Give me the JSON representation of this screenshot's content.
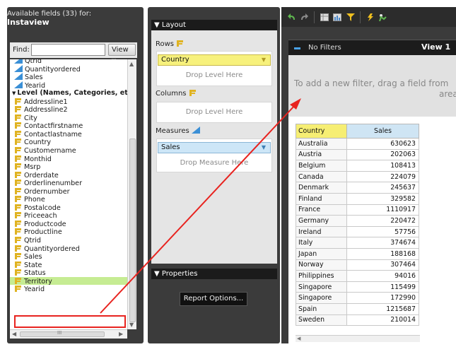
{
  "left": {
    "header_line1": "Available fields (33) for:",
    "header_line2": "Instaview",
    "find_label": "Find:",
    "find_value": "",
    "view_label": "View",
    "view_arrow": "▽",
    "fields": [
      {
        "label": "Qtrid",
        "kind": "measure",
        "partial": true
      },
      {
        "label": "Quantityordered",
        "kind": "measure"
      },
      {
        "label": "Sales",
        "kind": "measure"
      },
      {
        "label": "Yearid",
        "kind": "measure"
      },
      {
        "label": "Level (Names, Categories, etc",
        "kind": "group"
      },
      {
        "label": "Addressline1",
        "kind": "level"
      },
      {
        "label": "Addressline2",
        "kind": "level"
      },
      {
        "label": "City",
        "kind": "level"
      },
      {
        "label": "Contactfirstname",
        "kind": "level"
      },
      {
        "label": "Contactlastname",
        "kind": "level"
      },
      {
        "label": "Country",
        "kind": "level"
      },
      {
        "label": "Customername",
        "kind": "level"
      },
      {
        "label": "Monthid",
        "kind": "level"
      },
      {
        "label": "Msrp",
        "kind": "level"
      },
      {
        "label": "Orderdate",
        "kind": "level"
      },
      {
        "label": "Orderlinenumber",
        "kind": "level"
      },
      {
        "label": "Ordernumber",
        "kind": "level"
      },
      {
        "label": "Phone",
        "kind": "level"
      },
      {
        "label": "Postalcode",
        "kind": "level"
      },
      {
        "label": "Priceeach",
        "kind": "level"
      },
      {
        "label": "Productcode",
        "kind": "level"
      },
      {
        "label": "Productline",
        "kind": "level"
      },
      {
        "label": "Qtrid",
        "kind": "level"
      },
      {
        "label": "Quantityordered",
        "kind": "level"
      },
      {
        "label": "Sales",
        "kind": "level"
      },
      {
        "label": "State",
        "kind": "level"
      },
      {
        "label": "Status",
        "kind": "level"
      },
      {
        "label": "Territory",
        "kind": "level",
        "highlight": true
      },
      {
        "label": "Yearid",
        "kind": "level"
      }
    ],
    "hscroll_grip": "III"
  },
  "layout": {
    "title": "▼ Layout",
    "rows_label": "Rows",
    "rows_chip": "Country",
    "rows_drop": "Drop Level Here",
    "columns_label": "Columns",
    "columns_drop": "Drop Level Here",
    "measures_label": "Measures",
    "measures_chip": "Sales",
    "measures_drop": "Drop Measure Here",
    "properties_title": "▼ Properties",
    "report_options": "Report Options..."
  },
  "view": {
    "no_filters": "No Filters",
    "view_name": "View 1",
    "filter_msg_line1": "To add a new filter, drag a field from",
    "filter_msg_line2": "area."
  },
  "table": {
    "headers": [
      "Country",
      "Sales"
    ],
    "rows": [
      [
        "Australia",
        "630623"
      ],
      [
        "Austria",
        "202063"
      ],
      [
        "Belgium",
        "108413"
      ],
      [
        "Canada",
        "224079"
      ],
      [
        "Denmark",
        "245637"
      ],
      [
        "Finland",
        "329582"
      ],
      [
        "France",
        "1110917"
      ],
      [
        "Germany",
        "220472"
      ],
      [
        "Ireland",
        "57756"
      ],
      [
        "Italy",
        "374674"
      ],
      [
        "Japan",
        "188168"
      ],
      [
        "Norway",
        "307464"
      ],
      [
        "Philippines",
        "94016"
      ],
      [
        "Singapore",
        "115499"
      ],
      [
        "Singapore",
        "172990"
      ],
      [
        "Spain",
        "1215687"
      ],
      [
        "Sweden",
        "210014"
      ]
    ]
  },
  "colors": {
    "panel_dark": "#3b3b3b",
    "header_black": "#1b1b1b",
    "country_yellow": "#f6ee73",
    "sales_blue": "#cfe5f4",
    "territory_green": "#c6ec93",
    "annotation_red": "#e8231f"
  }
}
